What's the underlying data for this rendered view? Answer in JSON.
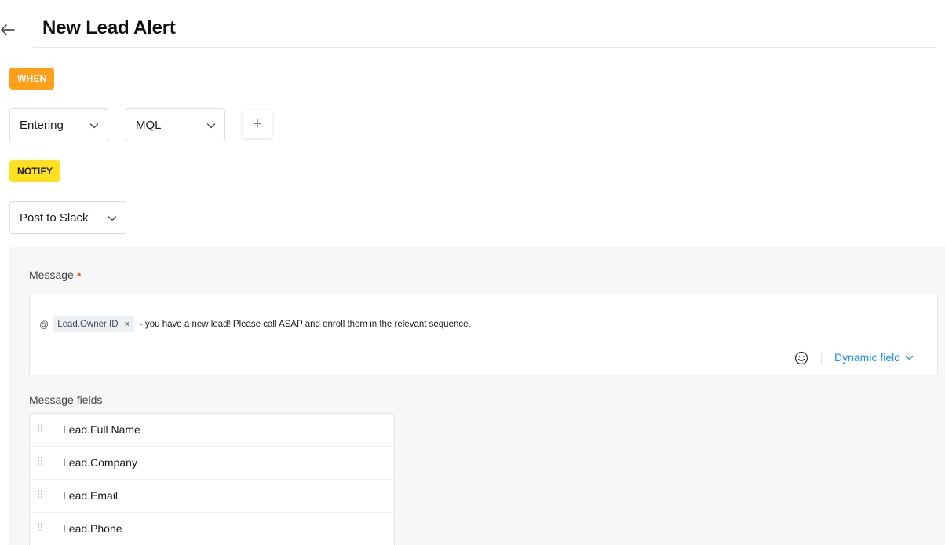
{
  "header": {
    "title": "New Lead Alert"
  },
  "trigger": {
    "badge": "WHEN",
    "event_select": "Entering",
    "stage_select": "MQL",
    "add_label": "+"
  },
  "action": {
    "badge": "NOTIFY",
    "channel_select": "Post to Slack"
  },
  "message": {
    "label": "Message",
    "required_marker": "•",
    "mention_prefix": "@",
    "chip_label": "Lead.Owner ID",
    "chip_remove": "×",
    "body": "- you have a new lead! Please call ASAP and enroll them in the relevant sequence.",
    "dynamic_field_label": "Dynamic field"
  },
  "message_fields": {
    "label": "Message fields",
    "items": [
      {
        "label": "Lead.Full Name"
      },
      {
        "label": "Lead.Company"
      },
      {
        "label": "Lead.Email"
      },
      {
        "label": "Lead.Phone"
      }
    ]
  },
  "colors": {
    "when_badge": "#ff9f1a",
    "notify_badge": "#ffe11f",
    "link_blue": "#1c8ce6",
    "required_dot": "#ff5a1f"
  },
  "icons": {
    "back": "arrow-left-icon",
    "chevron": "chevron-down-icon",
    "emoji": "smile-icon",
    "drag": "drag-handle-icon"
  }
}
